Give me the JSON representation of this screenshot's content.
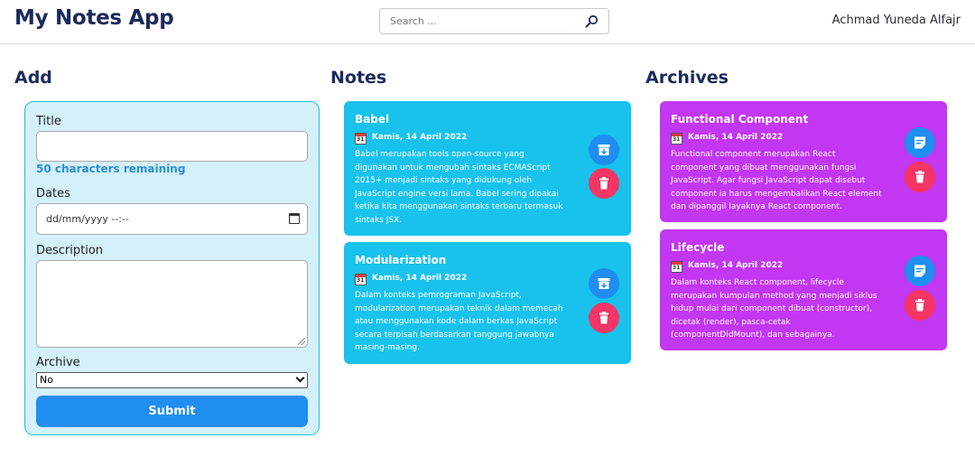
{
  "header": {
    "app_title": "My Notes App",
    "search_placeholder": "Search ...",
    "search_icon": "search-icon",
    "username": "Achmad Yuneda Alfajr"
  },
  "sections": {
    "add_title": "Add",
    "notes_title": "Notes",
    "archives_title": "Archives"
  },
  "form": {
    "title_label": "Title",
    "title_value": "",
    "remaining_text": "50 characters remaining",
    "dates_label": "Dates",
    "date_placeholder": "dd/mm/yyyy --:--",
    "description_label": "Description",
    "description_value": "",
    "archive_label": "Archive",
    "archive_selected": "No",
    "submit_label": "Submit"
  },
  "notes": [
    {
      "title": "Babel",
      "date": "Kamis, 14 April 2022",
      "body_lines": [
        "Babel merupakan tools open-source yang",
        "digunakan untuk mengubah sintaks ECMAScript",
        "2015+ menjadi sintaks yang didukung oleh",
        "JavaScript engine versi lama. Babel sering dipakai",
        "ketika kita menggunakan sintaks terbaru termasuk",
        "sintaks JSX."
      ],
      "action_icon": "archive-icon",
      "delete_icon": "trash-icon"
    },
    {
      "title": "Modularization",
      "date": "Kamis, 14 April 2022",
      "body_lines": [
        "Dalam konteks pemrograman JavaScript,",
        "modularization merupakan teknik dalam memecah",
        "atau menggunakan kode dalam berkas JavaScript",
        "secara terpisah berdasarkan tanggung jawabnya",
        "masing-masing."
      ],
      "action_icon": "archive-icon",
      "delete_icon": "trash-icon"
    }
  ],
  "archives": [
    {
      "title": "Functional Component",
      "date": "Kamis, 14 April 2022",
      "body_lines": [
        "Functional component merupakan React",
        "component yang dibuat menggunakan fungsi",
        "JavaScript. Agar fungsi JavaScript dapat disebut",
        "component ia harus mengembalikan React element",
        "dan dipanggil layaknya React component."
      ],
      "action_icon": "unarchive-icon",
      "delete_icon": "trash-icon"
    },
    {
      "title": "Lifecycle",
      "date": "Kamis, 14 April 2022",
      "body_lines": [
        "Dalam konteks React component, lifecycle",
        "merupakan kumpulan method yang menjadi siklus",
        "hidup mulai dari component dibuat (constructor),",
        "dicetak (render), pasca-cetak",
        "(componentDidMount), dan sebagainya."
      ],
      "action_icon": "unarchive-icon",
      "delete_icon": "trash-icon"
    }
  ],
  "colors": {
    "primary": "#1f8ef0",
    "note_card": "#18c2ec",
    "archive_card": "#c237f2",
    "delete": "#f33663",
    "form_bg": "#d4f0fa",
    "heading": "#1c2a5c"
  }
}
